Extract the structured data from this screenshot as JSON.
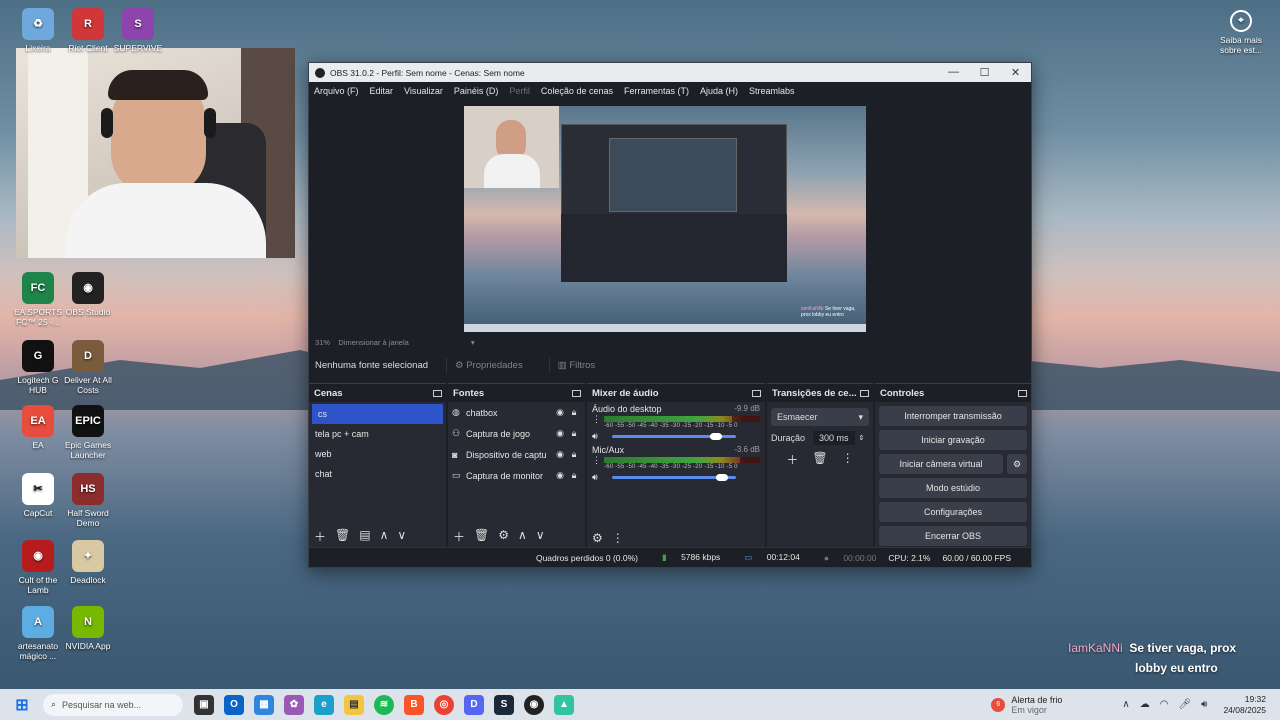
{
  "desktop": {
    "icons": [
      {
        "label": "Lixeira",
        "icon": "recycle-bin-icon",
        "color": "#6fa8dc",
        "glyph": "♻"
      },
      {
        "label": "Riot Client",
        "icon": "riot-client-icon",
        "color": "#d13639",
        "glyph": "R"
      },
      {
        "label": "SUPERVIVE",
        "icon": "supervive-icon",
        "color": "#8e44ad",
        "glyph": "S"
      },
      {
        "label": "EA SPORTS FC™ 25 -...",
        "icon": "ea-fc-icon",
        "color": "#1e8449",
        "glyph": "FC"
      },
      {
        "label": "OBS Studio",
        "icon": "obs-icon",
        "color": "#222222",
        "glyph": "◉"
      },
      {
        "label": "Logitech G HUB",
        "icon": "logitech-icon",
        "color": "#111111",
        "glyph": "G"
      },
      {
        "label": "Deliver At All Costs",
        "icon": "deliver-icon",
        "color": "#7a5c3c",
        "glyph": "D"
      },
      {
        "label": "EA",
        "icon": "ea-icon",
        "color": "#e74c3c",
        "glyph": "EA"
      },
      {
        "label": "Epic Games Launcher",
        "icon": "epic-games-icon",
        "color": "#111111",
        "glyph": "EPIC"
      },
      {
        "label": "CapCut",
        "icon": "capcut-icon",
        "color": "#ffffff",
        "glyph": "✂"
      },
      {
        "label": "Half Sword Demo",
        "icon": "half-sword-icon",
        "color": "#8b2d2d",
        "glyph": "HS"
      },
      {
        "label": "Cult of the Lamb",
        "icon": "cult-lamb-icon",
        "color": "#b71c1c",
        "glyph": "◉"
      },
      {
        "label": "Deadlock",
        "icon": "deadlock-icon",
        "color": "#d9c9a3",
        "glyph": "✦"
      },
      {
        "label": "artesanato mágico ...",
        "icon": "artesanato-icon",
        "color": "#5dade2",
        "glyph": "A"
      },
      {
        "label": "NVIDIA App",
        "icon": "nvidia-icon",
        "color": "#76b900",
        "glyph": "N"
      }
    ],
    "corner_widget": {
      "label": "Saiba mais sobre est...",
      "icon": "learn-more-icon"
    }
  },
  "obs": {
    "title": "OBS 31.0.2 - Perfil: Sem nome - Cenas: Sem nome",
    "menu": [
      "Arquivo (F)",
      "Editar",
      "Visualizar",
      "Painéis (D)",
      "Perfil",
      "Coleção de cenas",
      "Ferramentas (T)",
      "Ajuda (H)",
      "Streamlabs"
    ],
    "preview_zoom": "31%",
    "preview_scale_label": "Dimensionar à janela",
    "no_source_label": "Nenhuma fonte selecionad",
    "properties_label": "Propriedades",
    "filters_label": "Filtros",
    "scenes": {
      "title": "Cenas",
      "items": [
        "cs",
        "tela pc + cam",
        "web",
        "chat"
      ]
    },
    "sources": {
      "title": "Fontes",
      "items": [
        {
          "name": "chatbox",
          "icon": "browser-source-icon"
        },
        {
          "name": "Captura de jogo",
          "icon": "gamepad-icon"
        },
        {
          "name": "Dispositivo de captu",
          "icon": "camera-icon"
        },
        {
          "name": "Captura de monitor",
          "icon": "monitor-icon"
        }
      ]
    },
    "mixer": {
      "title": "Mixer de áudio",
      "channels": [
        {
          "name": "Áudio do desktop",
          "db": "-9.9 dB",
          "level": 0.82
        },
        {
          "name": "Mic/Aux",
          "db": "-3.6 dB",
          "level": 0.87
        }
      ],
      "scale": "-60 -55 -50 -45 -40 -35 -30 -25 -20 -15 -10 -5 0"
    },
    "transitions": {
      "title": "Transições de ce...",
      "type": "Esmaecer",
      "duration_label": "Duração",
      "duration": "300 ms"
    },
    "controls": {
      "title": "Controles",
      "buttons": [
        "Interromper transmissão",
        "Iniciar gravação",
        "Iniciar câmera virtual",
        "Modo estúdio",
        "Configurações",
        "Encerrar OBS"
      ]
    },
    "status": {
      "dropped": "Quadros perdidos 0 (0.0%)",
      "bitrate": "5786 kbps",
      "stream_time": "00:12:04",
      "rec_time": "00:00:00",
      "cpu": "CPU: 2.1%",
      "fps": "60.00 / 60.00 FPS"
    },
    "preview_chat": {
      "user": "iamKaNNi",
      "text": "Se tiver vaga, prox lobby eu entro"
    }
  },
  "chat_overlay": {
    "user": "IamKaNNi",
    "line1": "Se tiver vaga, prox",
    "line2": "lobby eu entro"
  },
  "taskbar": {
    "search_placeholder": "Pesquisar na web...",
    "weather_title": "Alerta de frio",
    "weather_sub": "Em vigor",
    "weather_badge": "6",
    "time": "19:32",
    "date": "24/08/2025"
  }
}
